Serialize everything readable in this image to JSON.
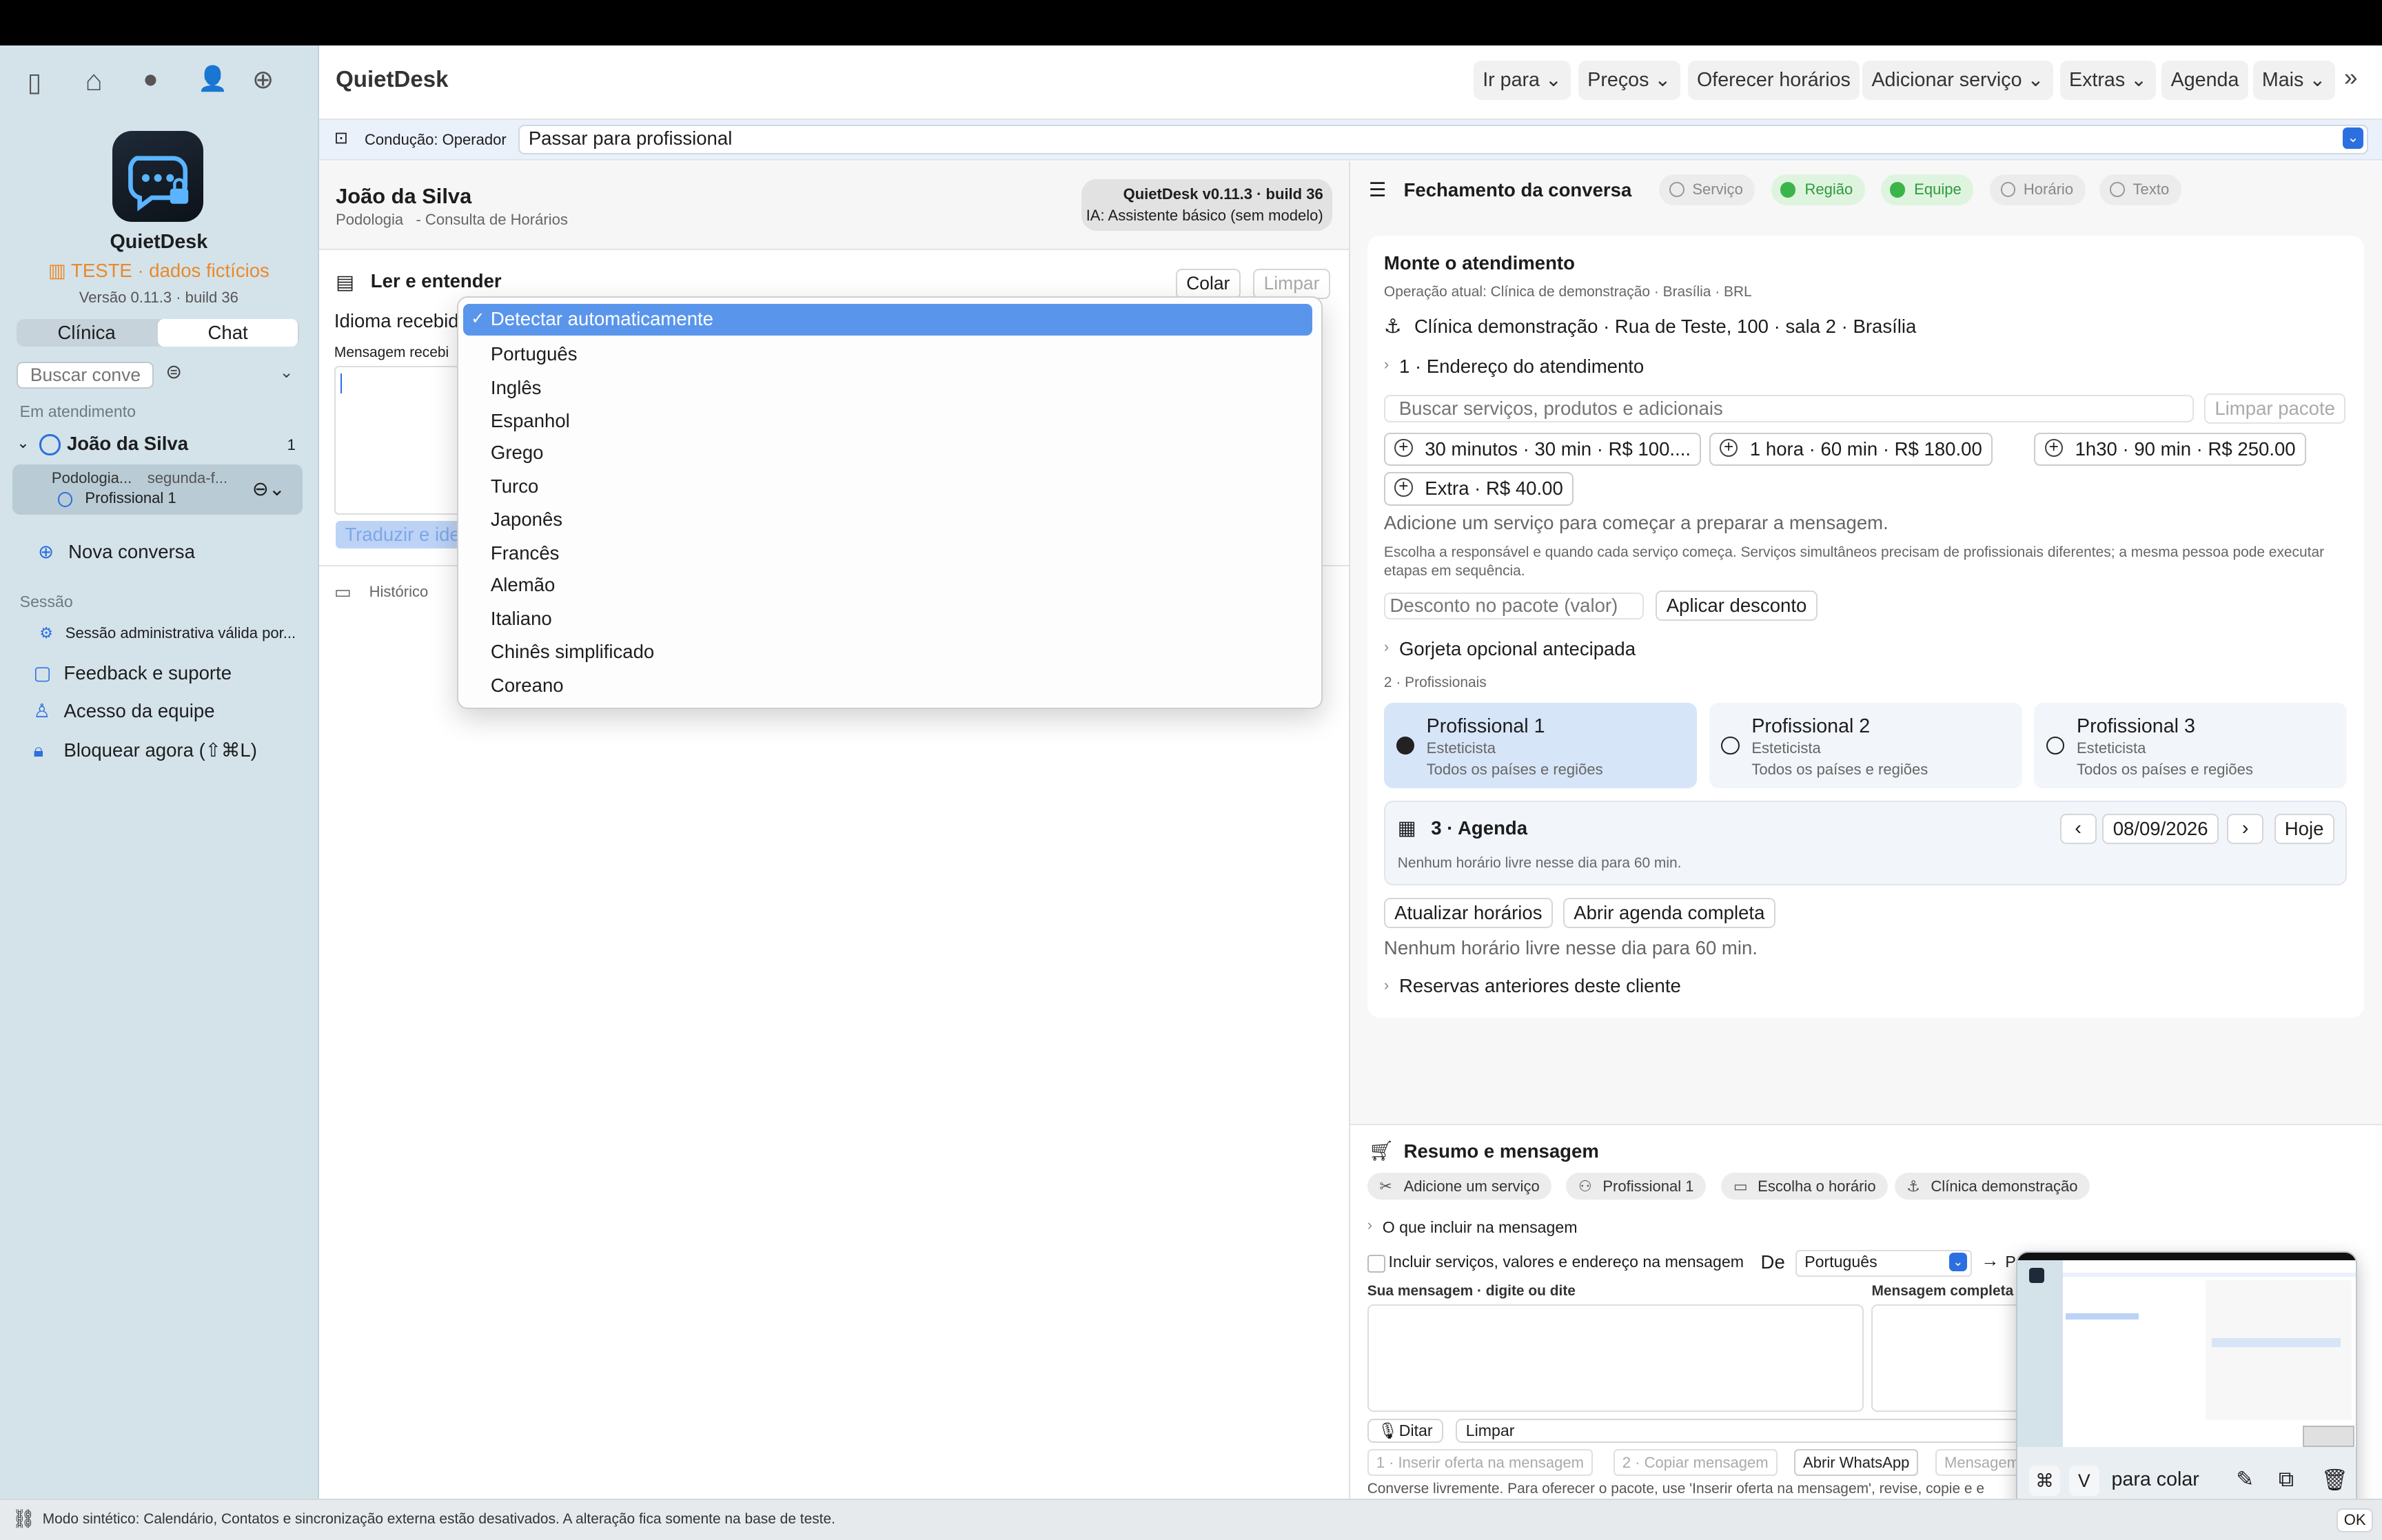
{
  "toolbar": {
    "app_title": "QuietDesk",
    "ir_para": "Ir para",
    "precos": "Preços",
    "oferecer": "Oferecer horários",
    "adicionar": "Adicionar serviço",
    "extras": "Extras",
    "agenda": "Agenda",
    "mais": "Mais"
  },
  "sidebar": {
    "app_name": "QuietDesk",
    "test_badge": "TESTE · dados fictícios",
    "version": "Versão 0.11.3 · build 36",
    "tab_clinica": "Clínica",
    "tab_chat": "Chat",
    "search_placeholder": "Buscar conve",
    "section_em": "Em atendimento",
    "contact_name": "João da Silva",
    "contact_count": "1",
    "contact_sub1": "Podologia...",
    "contact_sub2": "segunda-f...",
    "contact_prof": "Profissional 1",
    "nova": "Nova conversa",
    "section_sessao": "Sessão",
    "sessao_admin": "Sessão administrativa válida por...",
    "feedback": "Feedback e suporte",
    "acesso": "Acesso da equipe",
    "bloquear": "Bloquear agora (⇧⌘L)"
  },
  "conducao": {
    "label": "Condução: Operador",
    "select_value": "Passar para profissional"
  },
  "chat": {
    "name": "João da Silva",
    "sub": "Podologia   - Consulta de Horários",
    "version_line1": "QuietDesk v0.11.3 · build 36",
    "version_line2": "IA: Assistente básico (sem modelo)",
    "ler_title": "Ler e entender",
    "colar": "Colar",
    "limpar": "Limpar",
    "idioma_label": "Idioma recebid",
    "mensagem_label": "Mensagem recebi",
    "traduzir": "Traduzir e ide",
    "historico": "Histórico"
  },
  "dropdown": {
    "selected": "Detectar automaticamente",
    "options": [
      "Português",
      "Inglês",
      "Espanhol",
      "Grego",
      "Turco",
      "Japonês",
      "Francês",
      "Alemão",
      "Italiano",
      "Chinês simplificado",
      "Coreano"
    ]
  },
  "fechamento": {
    "title": "Fechamento da conversa",
    "chips": [
      {
        "label": "Serviço",
        "ok": false
      },
      {
        "label": "Região",
        "ok": true
      },
      {
        "label": "Equipe",
        "ok": true
      },
      {
        "label": "Horário",
        "ok": false
      },
      {
        "label": "Texto",
        "ok": false
      }
    ],
    "monte_title": "Monte o atendimento",
    "operacao": "Operação atual: Clínica de demonstração · Brasília · BRL",
    "clinica": "Clínica demonstração · Rua de Teste, 100 · sala 2 · Brasília",
    "endereco": "1 · Endereço do atendimento",
    "buscar_placeholder": "Buscar serviços, produtos e adicionais",
    "limpar_pacote": "Limpar pacote",
    "services": [
      "30 minutos · 30 min · R$ 100....",
      "1 hora · 60 min · R$ 180.00",
      "1h30 · 90 min · R$ 250.00",
      "Extra · R$ 40.00"
    ],
    "adicione": "Adicione um serviço para começar a preparar a mensagem.",
    "escolha": "Escolha a responsável e quando cada serviço começa. Serviços simultâneos precisam de profissionais diferentes; a mesma pessoa pode executar etapas em sequência.",
    "desconto_placeholder": "Desconto no pacote (valor)",
    "aplicar": "Aplicar desconto",
    "gorjeta": "Gorjeta opcional antecipada",
    "profissionais_label": "2 · Profissionais",
    "profissionais": [
      {
        "name": "Profissional 1",
        "role": "Esteticista",
        "region": "Todos os países e regiões"
      },
      {
        "name": "Profissional 2",
        "role": "Esteticista",
        "region": "Todos os países e regiões"
      },
      {
        "name": "Profissional 3",
        "role": "Esteticista",
        "region": "Todos os países e regiões"
      }
    ],
    "agenda_title": "3 · Agenda",
    "date": "08/09/2026",
    "hoje": "Hoje",
    "nenhum": "Nenhum horário livre nesse dia para 60 min.",
    "atualizar": "Atualizar horários",
    "abrir_agenda": "Abrir agenda completa",
    "nenhum2": "Nenhum horário livre nesse dia para 60 min.",
    "reservas": "Reservas anteriores deste cliente"
  },
  "resumo": {
    "title": "Resumo e mensagem",
    "chips": [
      "Adicione um serviço",
      "Profissional 1",
      "Escolha o horário",
      "Clínica demonstração"
    ],
    "incluir_title": "O que incluir na mensagem",
    "checkbox": "Incluir serviços, valores e endereço na mensagem",
    "de": "De",
    "lang": "Português",
    "para": "P",
    "sua_label": "Sua mensagem · digite ou dite",
    "completa_label": "Mensagem completa",
    "ditar": "Ditar",
    "limpar": "Limpar",
    "inserir": "1 · Inserir oferta na mensagem",
    "copiar": "2 · Copiar mensagem",
    "whatsapp": "Abrir WhatsApp",
    "mensagem_cut": "Mensagem",
    "footer": "Converse livremente. Para oferecer o pacote, use 'Inserir oferta na mensagem', revise, copie e e"
  },
  "paste_hint": {
    "cmd": "⌘",
    "v": "V",
    "label": "para colar"
  },
  "status_bar": "Modo sintético: Calendário, Contatos e sincronização externa estão desativados. A alteração fica somente na base de teste.",
  "ok": "OK",
  "colors": {
    "accent": "#2c6fe0",
    "sidebar_bg": "#d4e3ea",
    "test_orange": "#e8892c",
    "success": "#3bb54a"
  }
}
